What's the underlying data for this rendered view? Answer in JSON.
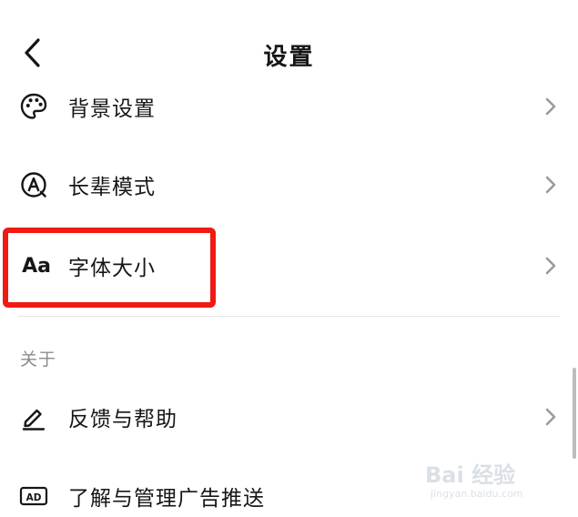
{
  "header": {
    "title": "设置",
    "back_icon": "chevron-left-icon"
  },
  "settings": {
    "items": [
      {
        "label": "背景设置",
        "icon": "palette-icon"
      },
      {
        "label": "长辈模式",
        "icon": "elder-mode-icon"
      },
      {
        "label": "字体大小",
        "icon": "font-size-icon",
        "icon_text": "Aa"
      }
    ]
  },
  "about": {
    "section_label": "关于",
    "items": [
      {
        "label": "反馈与帮助",
        "icon": "pencil-icon"
      },
      {
        "label": "了解与管理广告推送",
        "icon": "ad-icon",
        "icon_text": "AD"
      }
    ]
  },
  "annotation": {
    "highlight_color": "#f01a14"
  },
  "watermark": {
    "brand": "Bai 经验",
    "domain": "jingyan.baidu.com"
  },
  "colors": {
    "text": "#161616",
    "secondary_text": "#8c8c8c",
    "chevron": "#9a9a9a",
    "divider": "#e4e4e4"
  }
}
